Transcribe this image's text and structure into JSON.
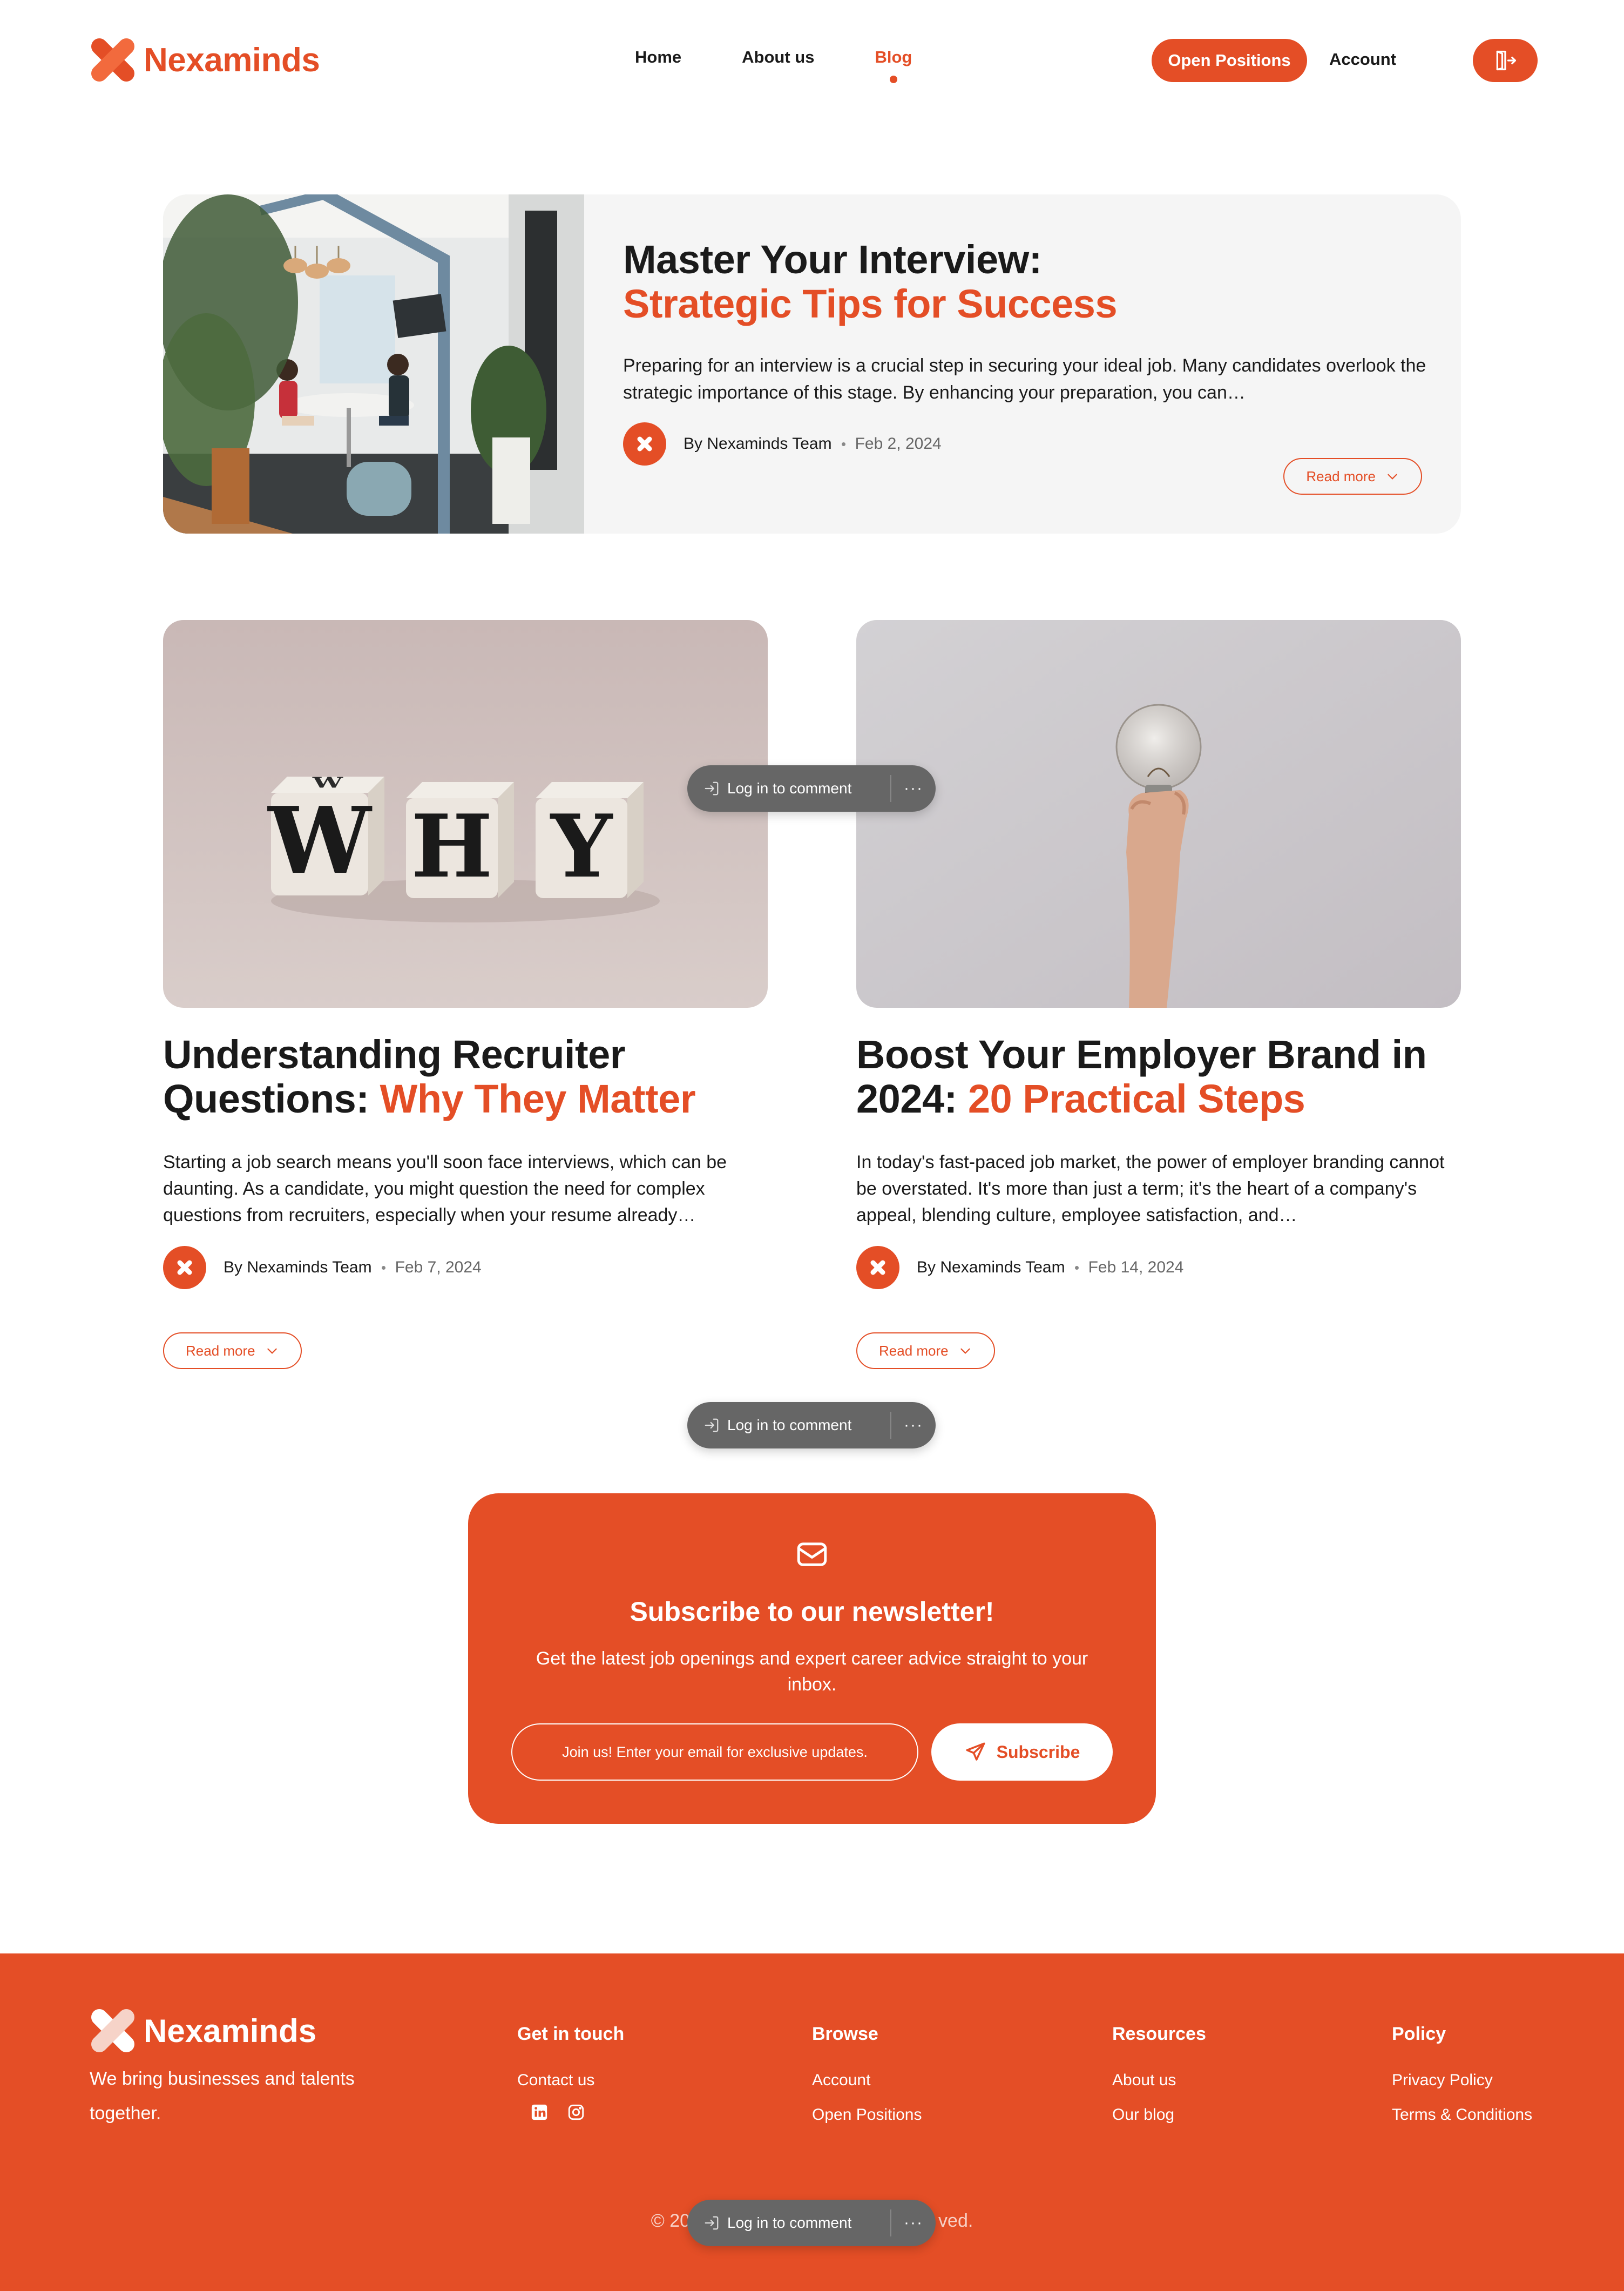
{
  "brand": {
    "name": "Nexaminds",
    "accent_color": "#e44e26"
  },
  "header": {
    "nav": [
      {
        "label": "Home"
      },
      {
        "label": "About us"
      },
      {
        "label": "Blog",
        "active": true
      }
    ],
    "open_positions_label": "Open Positions",
    "account_label": "Account",
    "logout_icon": "logout-icon"
  },
  "featured": {
    "title_line1": "Master Your Interview:",
    "title_line2": "Strategic Tips for Success",
    "excerpt": "Preparing for an interview is a crucial step in securing your ideal job. Many candidates overlook the strategic importance of this stage. By enhancing your preparation, you can…",
    "author": "By Nexaminds Team",
    "date": "Feb 2, 2024",
    "read_more": "Read more"
  },
  "posts": [
    {
      "title_plain": "Understanding Recruiter Questions:",
      "title_accent": "Why They Matter",
      "excerpt": "Starting a job search means you'll soon face interviews, which can be daunting. As a candidate, you might question the need for complex questions from recruiters, especially when your resume already…",
      "author": "By Nexaminds Team",
      "date": "Feb 7, 2024",
      "read_more": "Read more"
    },
    {
      "title_plain": "Boost Your Employer Brand in 2024:",
      "title_accent": "20 Practical Steps",
      "excerpt": "In today's fast-paced job market, the power of employer branding cannot be overstated. It's more than just a term; it's the heart of a company's appeal, blending culture, employee satisfaction, and…",
      "author": "By Nexaminds Team",
      "date": "Feb 14, 2024",
      "read_more": "Read more"
    }
  ],
  "comment_overlay": {
    "label": "Log in to comment",
    "more": "···"
  },
  "newsletter": {
    "title": "Subscribe to our newsletter!",
    "subtitle": "Get the latest job openings and expert career advice straight to your inbox.",
    "placeholder": "Join us! Enter your email for exclusive updates.",
    "button": "Subscribe"
  },
  "footer": {
    "tagline": "We bring businesses and talents together.",
    "columns": [
      {
        "title": "Get in touch",
        "links": [
          "Contact us"
        ]
      },
      {
        "title": "Browse",
        "links": [
          "Account",
          "Open Positions"
        ]
      },
      {
        "title": "Resources",
        "links": [
          "About us",
          "Our blog"
        ]
      },
      {
        "title": "Policy",
        "links": [
          "Privacy Policy",
          "Terms & Conditions"
        ]
      }
    ],
    "copyright_left": "© 20",
    "copyright_right": "ved."
  }
}
